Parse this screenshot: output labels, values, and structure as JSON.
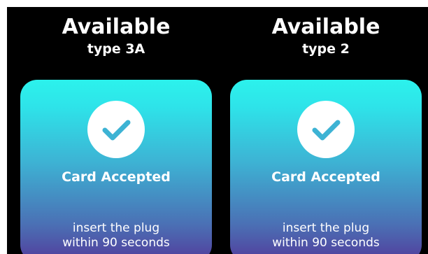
{
  "connectors": [
    {
      "status": "Available",
      "type": "type 3A",
      "card_status": "Card Accepted",
      "instruction_line1": "insert the plug",
      "instruction_line2": "within 90 seconds",
      "icon": "checkmark-circle-icon"
    },
    {
      "status": "Available",
      "type": "type 2",
      "card_status": "Card Accepted",
      "instruction_line1": "insert the plug",
      "instruction_line2": "within 90 seconds",
      "icon": "checkmark-circle-icon"
    }
  ],
  "colors": {
    "background": "#000000",
    "card_gradient_top": "#2cf2ec",
    "card_gradient_bottom": "#523c9c",
    "text": "#ffffff",
    "check": "#3db3d4"
  }
}
